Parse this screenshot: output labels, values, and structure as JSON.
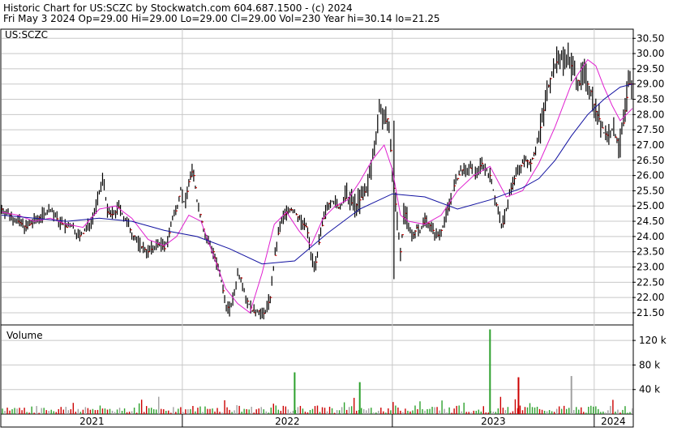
{
  "header": {
    "line1": "Historic Chart for US:SCZC by Stockwatch.com 604.687.1500 - (c) 2024",
    "line2": "Fri May  3 2024  Op=29.00  Hi=29.00  Lo=29.00  Cl=29.00  Vol=230  Year hi=30.14  lo=21.25"
  },
  "chart_data": [
    {
      "type": "line",
      "panel": "price",
      "symbol_label": "US:SCZC",
      "y_ticks": [
        "30.50",
        "30.00",
        "29.50",
        "29.00",
        "28.50",
        "28.00",
        "27.50",
        "27.00",
        "26.50",
        "26.00",
        "25.50",
        "25.00",
        "24.50",
        "24.00",
        "23.50",
        "23.00",
        "22.50",
        "22.00",
        "21.50"
      ],
      "ylim": [
        21.1,
        30.8
      ],
      "x_ticks": [
        "2021",
        "2022",
        "2023",
        "2024"
      ],
      "year_hi": 30.14,
      "year_lo": 21.25,
      "last_close": 29.0,
      "colors": {
        "price_bars": "#000000",
        "ma_short": "#e020d0",
        "ma_long": "#1010a0",
        "down_tick": "#cc0000"
      },
      "series": [
        {
          "role": "price-close",
          "x": [
            0,
            5,
            10,
            15,
            20,
            25,
            30,
            35,
            40,
            45,
            50,
            55,
            60,
            65,
            70,
            75,
            80,
            85,
            90,
            95,
            100,
            105,
            110,
            115,
            120,
            125,
            130,
            135,
            140,
            145,
            150,
            155,
            160,
            165,
            170,
            175,
            180,
            185,
            190,
            195,
            200,
            205,
            210,
            215,
            220,
            225,
            230,
            235,
            240,
            245,
            250,
            255,
            260,
            265,
            270,
            275,
            280,
            285,
            290,
            295,
            300,
            305,
            310,
            315,
            320,
            325,
            330,
            335,
            340,
            345,
            350,
            355,
            360,
            365,
            370,
            375,
            380,
            385,
            390,
            395,
            400,
            405,
            410,
            415,
            420,
            425,
            430,
            435,
            440,
            445,
            450,
            455,
            460,
            465,
            470,
            475,
            480,
            485,
            490,
            495,
            500,
            505,
            510,
            515,
            520,
            525,
            530,
            535,
            540,
            545,
            550,
            555,
            560,
            565,
            570,
            575,
            580,
            585,
            590,
            595,
            600,
            605,
            610,
            615,
            620,
            625,
            630,
            635,
            640,
            645,
            650,
            655,
            660,
            665,
            670,
            675,
            680,
            685,
            690,
            695,
            700,
            705,
            710,
            715,
            720,
            725,
            730,
            735,
            740,
            745,
            750,
            755,
            760,
            765,
            770,
            775
          ],
          "values": [
            24.9,
            24.8,
            24.7,
            24.6,
            24.5,
            24.4,
            24.3,
            24.4,
            24.5,
            24.6,
            24.7,
            24.8,
            24.9,
            24.7,
            24.5,
            24.4,
            24.3,
            24.4,
            24.2,
            24.0,
            24.1,
            24.3,
            24.5,
            24.9,
            25.4,
            26.0,
            24.8,
            24.7,
            24.8,
            25.0,
            24.6,
            24.4,
            24.1,
            23.9,
            23.7,
            23.6,
            23.5,
            23.6,
            23.7,
            23.8,
            23.6,
            24.0,
            24.6,
            24.9,
            25.6,
            25.0,
            25.8,
            26.2,
            25.2,
            24.6,
            24.0,
            23.8,
            23.5,
            23.0,
            22.5,
            21.8,
            21.6,
            22.0,
            22.8,
            22.6,
            22.0,
            21.7,
            21.5,
            21.6,
            21.4,
            21.6,
            22.0,
            23.2,
            24.1,
            24.6,
            24.8,
            24.9,
            24.8,
            24.6,
            24.4,
            24.3,
            23.4,
            23.0,
            23.8,
            24.5,
            25.0,
            25.2,
            25.1,
            24.9,
            25.2,
            25.3,
            25.1,
            25.0,
            25.2,
            25.4,
            25.7,
            26.4,
            27.4,
            28.4,
            27.7,
            27.9,
            26.1,
            24.8,
            23.5,
            24.9,
            24.2,
            24.0,
            24.3,
            24.2,
            24.6,
            24.4,
            24.2,
            24.0,
            24.2,
            24.6,
            25.1,
            25.6,
            25.9,
            26.2,
            26.1,
            26.3,
            26.0,
            26.2,
            26.4,
            26.2,
            26.0,
            25.4,
            24.8,
            24.3,
            24.9,
            25.5,
            25.9,
            26.2,
            26.4,
            26.5,
            26.4,
            26.8,
            27.3,
            28.0,
            28.7,
            29.3,
            29.6,
            29.9,
            29.8,
            30.0,
            29.6,
            29.3,
            29.0,
            29.4,
            29.0,
            28.7,
            28.1,
            27.8,
            27.4,
            27.3,
            27.5,
            27.2,
            27.0,
            27.9,
            29.0,
            29.0
          ]
        },
        {
          "role": "moving-average-short",
          "x": [
            0,
            20,
            40,
            60,
            80,
            100,
            120,
            140,
            160,
            180,
            200,
            215,
            230,
            245,
            260,
            275,
            290,
            305,
            320,
            335,
            350,
            365,
            380,
            395,
            410,
            425,
            440,
            455,
            470,
            480,
            490,
            500,
            520,
            540,
            560,
            580,
            600,
            620,
            640,
            660,
            680,
            700,
            720,
            730,
            740,
            750,
            760,
            775
          ],
          "values": [
            24.8,
            24.7,
            24.5,
            24.6,
            24.4,
            24.3,
            24.9,
            25.0,
            24.6,
            23.9,
            23.7,
            24.0,
            24.7,
            24.5,
            23.4,
            22.3,
            21.8,
            21.5,
            22.8,
            24.4,
            24.8,
            24.2,
            23.7,
            24.6,
            25.0,
            25.2,
            25.8,
            26.5,
            27.0,
            26.2,
            24.7,
            24.5,
            24.4,
            24.7,
            25.5,
            26.0,
            26.3,
            25.3,
            25.5,
            26.4,
            27.6,
            29.0,
            29.8,
            29.6,
            28.9,
            28.3,
            27.8,
            28.2
          ]
        },
        {
          "role": "moving-average-long",
          "x": [
            0,
            40,
            80,
            120,
            160,
            200,
            240,
            280,
            320,
            360,
            400,
            440,
            480,
            520,
            560,
            600,
            620,
            640,
            660,
            680,
            700,
            720,
            740,
            760,
            775
          ],
          "values": [
            24.7,
            24.6,
            24.5,
            24.6,
            24.5,
            24.2,
            24.0,
            23.6,
            23.1,
            23.2,
            24.1,
            24.9,
            25.4,
            25.3,
            24.9,
            25.2,
            25.4,
            25.6,
            25.9,
            26.5,
            27.3,
            28.0,
            28.5,
            28.9,
            29.0
          ]
        }
      ]
    },
    {
      "type": "bar",
      "panel": "volume",
      "title": "Volume",
      "y_ticks": [
        "120 k",
        "80 k",
        "40 k"
      ],
      "ylim": [
        0,
        140000
      ],
      "max_volume_approx": 140000,
      "peaks": [
        {
          "x_day": 600,
          "value": 138000,
          "color": "#2ca02c"
        },
        {
          "x_day": 360,
          "value": 68000,
          "color": "#2ca02c"
        },
        {
          "x_day": 700,
          "value": 62000,
          "color": "#a0a0a0"
        },
        {
          "x_day": 635,
          "value": 60000,
          "color": "#cc0000"
        },
        {
          "x_day": 440,
          "value": 52000,
          "color": "#2ca02c"
        }
      ]
    }
  ]
}
